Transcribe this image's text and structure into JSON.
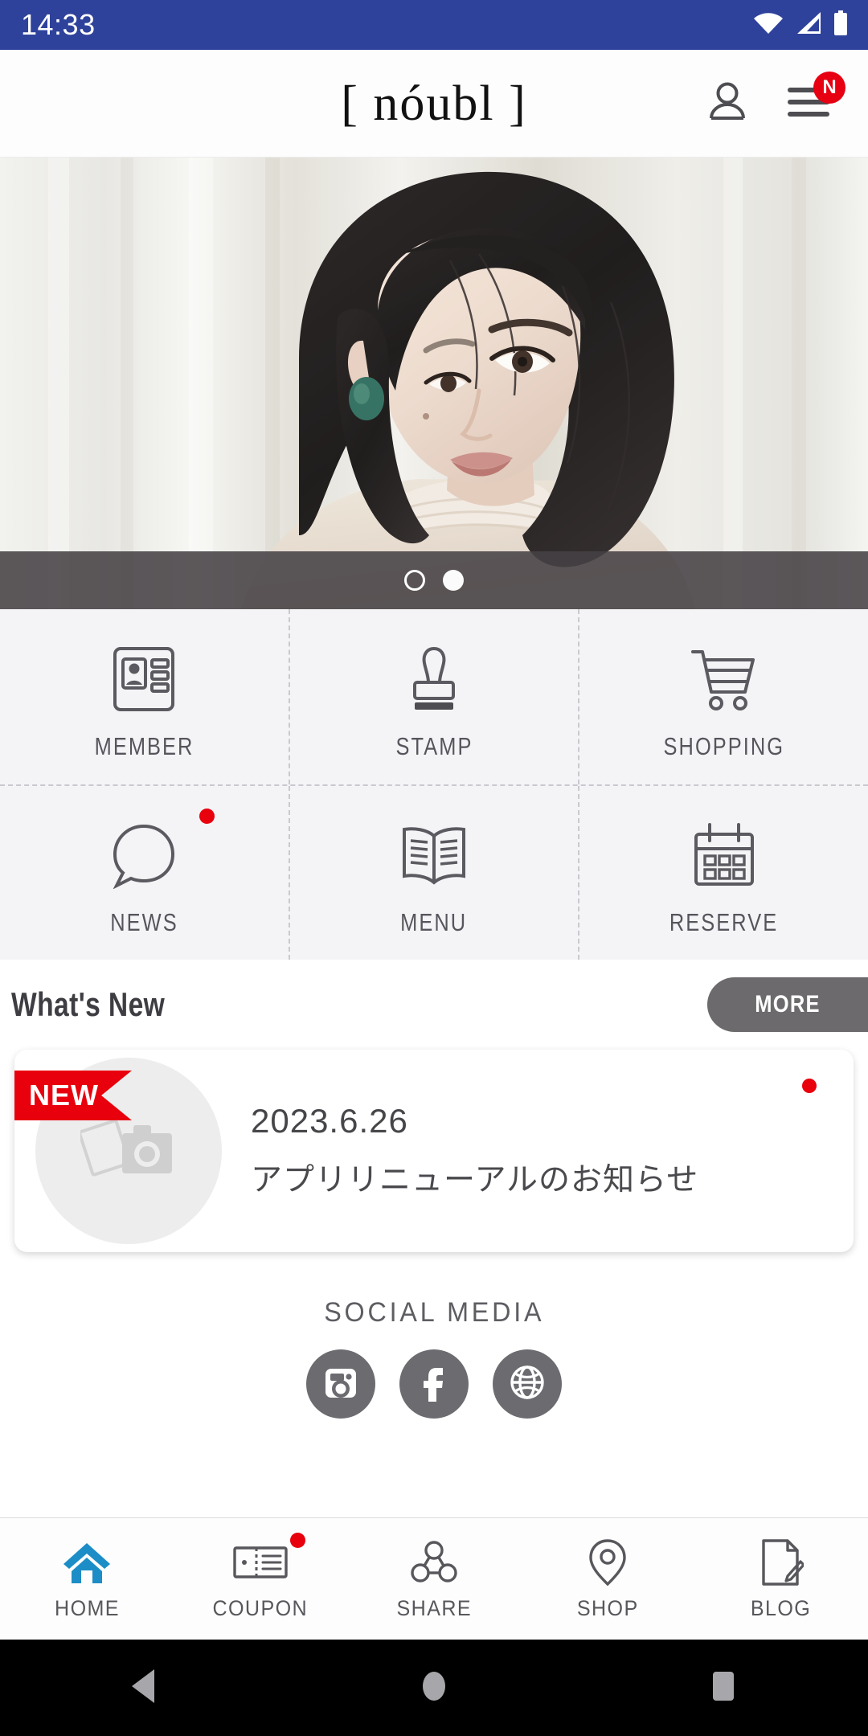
{
  "status_bar": {
    "time": "14:33",
    "icons": [
      "wifi-icon",
      "cellular-signal-icon",
      "battery-icon"
    ],
    "background": "#2f429b"
  },
  "header": {
    "logo": "[ nóubl ]",
    "account_icon": "person-icon",
    "menu_icon": "hamburger-menu-icon",
    "menu_badge": "N",
    "badge_color": "#e60012"
  },
  "hero": {
    "alt": "hair-salon-model-portrait",
    "carousel": {
      "total": 2,
      "active_index": 1,
      "dots": [
        "inactive",
        "active"
      ]
    }
  },
  "grid": {
    "rows": [
      [
        {
          "label": "MEMBER",
          "icon": "id-card-icon",
          "badge": false
        },
        {
          "label": "STAMP",
          "icon": "rubber-stamp-icon",
          "badge": false
        },
        {
          "label": "SHOPPING",
          "icon": "shopping-cart-icon",
          "badge": false
        }
      ],
      [
        {
          "label": "NEWS",
          "icon": "speech-bubble-icon",
          "badge": true
        },
        {
          "label": "MENU",
          "icon": "open-book-icon",
          "badge": false
        },
        {
          "label": "RESERVE",
          "icon": "calendar-icon",
          "badge": false
        }
      ]
    ],
    "badge_color": "#e8000d",
    "background": "#f4f4f6"
  },
  "whats_new": {
    "title": "What's New",
    "more_label": "MORE",
    "more_color": "#6d6a6d",
    "items": [
      {
        "ribbon": "NEW",
        "date": "2023.6.26",
        "title": "アプリリニューアルのお知らせ",
        "thumbnail": "photo-placeholder-icon",
        "unread": true
      }
    ]
  },
  "social": {
    "title": "SOCIAL MEDIA",
    "icons": [
      {
        "name": "instagram-icon"
      },
      {
        "name": "facebook-icon"
      },
      {
        "name": "website-globe-icon"
      }
    ],
    "circle_color": "#6b6b70"
  },
  "bottom_nav": {
    "active_color": "#1c8dc6",
    "items": [
      {
        "label": "HOME",
        "icon": "home-icon",
        "active": true,
        "badge": false
      },
      {
        "label": "COUPON",
        "icon": "coupon-ticket-icon",
        "active": false,
        "badge": true
      },
      {
        "label": "SHARE",
        "icon": "share-nodes-icon",
        "active": false,
        "badge": false
      },
      {
        "label": "SHOP",
        "icon": "location-pin-icon",
        "active": false,
        "badge": false
      },
      {
        "label": "BLOG",
        "icon": "document-pencil-icon",
        "active": false,
        "badge": false
      }
    ]
  },
  "android_nav": {
    "back": "back-triangle-icon",
    "home": "home-circle-icon",
    "recents": "recents-square-icon"
  }
}
